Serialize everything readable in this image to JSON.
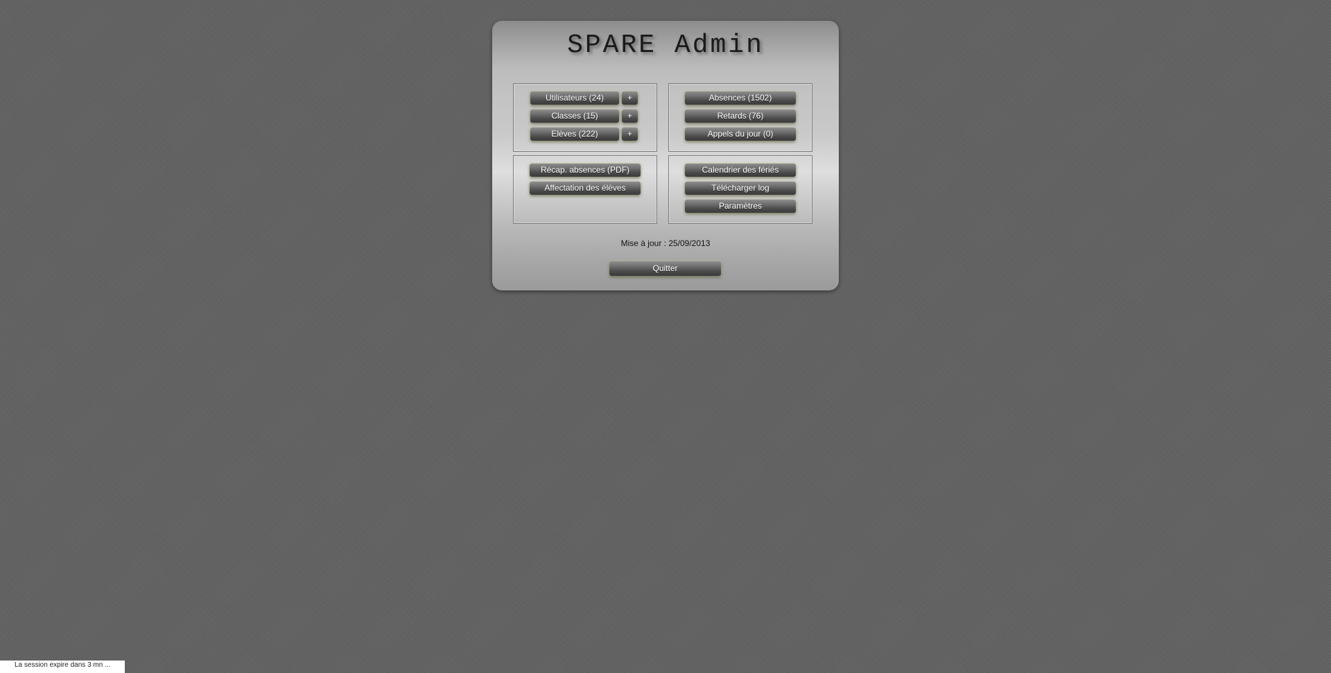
{
  "title": "SPARE Admin",
  "box_users": {
    "utilisateurs": "Utilisateurs (24)",
    "classes": "Classes (15)",
    "eleves": "Elèves (222)",
    "plus": "+"
  },
  "box_absences": {
    "absences": "Absences (1502)",
    "retards": "Retards (76)",
    "appels": "Appels du jour (0)"
  },
  "box_reports": {
    "recap": "Récap. absences (PDF)",
    "affectation": "Affectation des élèves"
  },
  "box_settings": {
    "calendrier": "Calendrier des fériés",
    "log": "Télécharger log",
    "parametres": "Paramètres"
  },
  "update_info": "Mise à jour : 25/09/2013",
  "quit_label": "Quitter",
  "session_notice": "La session expire dans 3 mn ..."
}
